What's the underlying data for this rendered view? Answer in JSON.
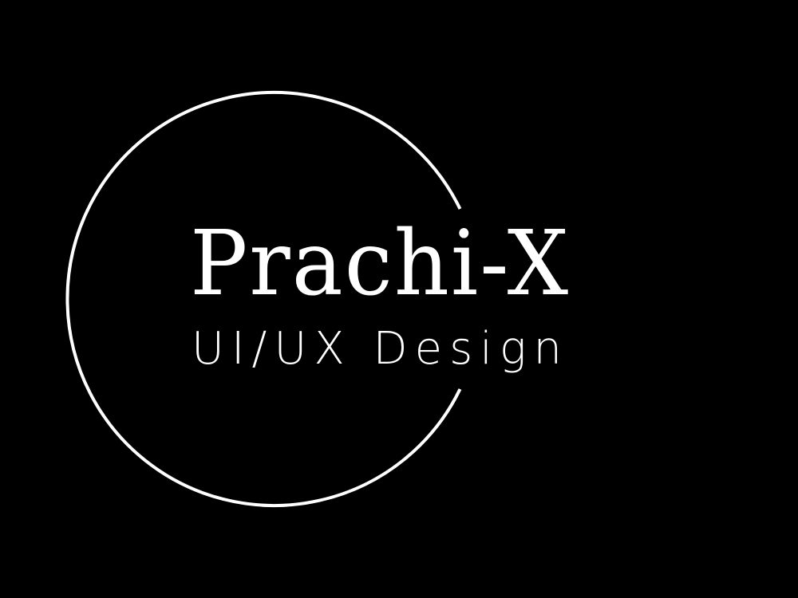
{
  "logo": {
    "name": "Prachi-X",
    "tagline": "UI/UX Design",
    "background_color": "#000000",
    "foreground_color": "#ffffff",
    "mark": "open-circle-ring"
  }
}
